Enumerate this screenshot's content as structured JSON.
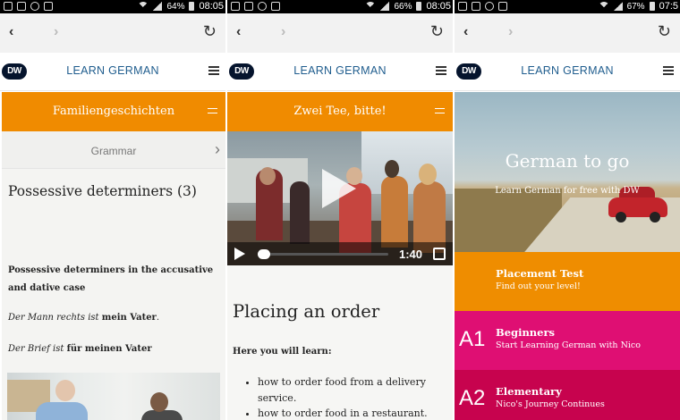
{
  "colors": {
    "accent_orange": "#f08b00",
    "dw_blue": "#1f5d8e",
    "a1_pink": "#df0f73",
    "a2_crimson": "#c7034e"
  },
  "panels": [
    {
      "status": {
        "battery": "64%",
        "time": "08:05"
      },
      "site": {
        "logo": "DW",
        "title": "LEARN GERMAN"
      },
      "orange_title": "Familiengeschichten",
      "nav_label": "Grammar",
      "heading": "Possessive determiners (3)",
      "subheading": "Possessive determiners in the accusative and dative case",
      "examples": [
        {
          "italic": "Der Mann rechts ist",
          "bold": "mein Vater",
          "end": "."
        },
        {
          "italic": "Der Brief ist",
          "bold": "für meinen Vater",
          "end": ""
        }
      ]
    },
    {
      "status": {
        "battery": "66%",
        "time": "08:05"
      },
      "site": {
        "logo": "DW",
        "title": "LEARN GERMAN"
      },
      "orange_title": "Zwei Tee, bitte!",
      "video_time": "1:40",
      "heading": "Placing an order",
      "subheading": "Here you will learn:",
      "learn_items": [
        "how to order food from a delivery service.",
        "how to order food in a restaurant."
      ]
    },
    {
      "status": {
        "battery": "67%",
        "time": "07:5"
      },
      "site": {
        "logo": "DW",
        "title": "LEARN GERMAN"
      },
      "hero_title": "German to go",
      "hero_subtitle": "Learn German for free with DW",
      "tiles": [
        {
          "code": "",
          "title": "Placement Test",
          "subtitle": "Find out your level!"
        },
        {
          "code": "A1",
          "title": "Beginners",
          "subtitle": "Start Learning German with Nico"
        },
        {
          "code": "A2",
          "title": "Elementary",
          "subtitle": "Nico's Journey Continues"
        }
      ]
    }
  ],
  "icons": {
    "back": "‹",
    "forward": "›",
    "reload": "↻",
    "chevron": "›"
  }
}
